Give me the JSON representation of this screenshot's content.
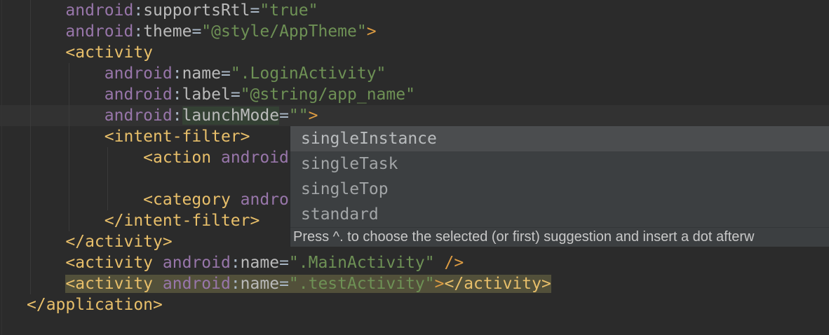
{
  "editor": {
    "background": "#2b2b2b",
    "caret_line_background": "#323232",
    "indent_guide_color": "#3a3a3a",
    "edge_line_color": "#343434",
    "colors": {
      "plain": "#a9b7c6",
      "tag": "#e8bf6a",
      "bracket": "#dd9c42",
      "ns": "#9876aa",
      "attr": "#bababa",
      "punct": "#a9b7c6",
      "str": "#6e9155"
    },
    "highlights": {
      "identifier": "#344134",
      "weak_warning": "#52503a"
    },
    "lines": [
      {
        "tokens": [
          {
            "t": "    "
          },
          {
            "t": "android",
            "c": "ns"
          },
          {
            "t": ":",
            "c": "punct"
          },
          {
            "t": "supportsRtl",
            "c": "attr"
          },
          {
            "t": "=",
            "c": "punct"
          },
          {
            "t": "\"true\"",
            "c": "str"
          }
        ]
      },
      {
        "tokens": [
          {
            "t": "    "
          },
          {
            "t": "android",
            "c": "ns"
          },
          {
            "t": ":",
            "c": "punct"
          },
          {
            "t": "theme",
            "c": "attr"
          },
          {
            "t": "=",
            "c": "punct"
          },
          {
            "t": "\"@style/AppTheme\"",
            "c": "str"
          },
          {
            "t": ">",
            "c": "bracket"
          }
        ]
      },
      {
        "tokens": [
          {
            "t": "    "
          },
          {
            "t": "<activity",
            "c": "tag"
          }
        ]
      },
      {
        "tokens": [
          {
            "t": "        "
          },
          {
            "t": "android",
            "c": "ns"
          },
          {
            "t": ":",
            "c": "punct"
          },
          {
            "t": "name",
            "c": "attr"
          },
          {
            "t": "=",
            "c": "punct"
          },
          {
            "t": "\".LoginActivity\"",
            "c": "str"
          }
        ]
      },
      {
        "tokens": [
          {
            "t": "        "
          },
          {
            "t": "android",
            "c": "ns"
          },
          {
            "t": ":",
            "c": "punct"
          },
          {
            "t": "label",
            "c": "attr"
          },
          {
            "t": "=",
            "c": "punct"
          },
          {
            "t": "\"@string/app_name\"",
            "c": "str"
          }
        ]
      },
      {
        "tokens": [
          {
            "t": "        "
          },
          {
            "t": "android",
            "c": "ns"
          },
          {
            "t": ":",
            "c": "punct"
          },
          {
            "t": "launchMode",
            "c": "attr",
            "bg": "identifier"
          },
          {
            "t": "=",
            "c": "punct"
          },
          {
            "t": "\"\"",
            "c": "str"
          },
          {
            "t": ">",
            "c": "bracket"
          }
        ]
      },
      {
        "tokens": [
          {
            "t": "        "
          },
          {
            "t": "<intent-filter>",
            "c": "tag"
          }
        ]
      },
      {
        "tokens": [
          {
            "t": "            "
          },
          {
            "t": "<action",
            "c": "tag"
          },
          {
            "t": " "
          },
          {
            "t": "android",
            "c": "ns"
          }
        ]
      },
      {
        "tokens": []
      },
      {
        "tokens": [
          {
            "t": "            "
          },
          {
            "t": "<category",
            "c": "tag"
          },
          {
            "t": " "
          },
          {
            "t": "andro",
            "c": "ns"
          }
        ]
      },
      {
        "tokens": [
          {
            "t": "        "
          },
          {
            "t": "</intent-filter>",
            "c": "tag"
          }
        ]
      },
      {
        "tokens": [
          {
            "t": "    "
          },
          {
            "t": "</activity>",
            "c": "tag"
          }
        ]
      },
      {
        "tokens": [
          {
            "t": "    "
          },
          {
            "t": "<activity",
            "c": "tag"
          },
          {
            "t": " "
          },
          {
            "t": "android",
            "c": "ns"
          },
          {
            "t": ":",
            "c": "punct"
          },
          {
            "t": "name",
            "c": "attr"
          },
          {
            "t": "=",
            "c": "punct"
          },
          {
            "t": "\".MainActivity\"",
            "c": "str"
          },
          {
            "t": " "
          },
          {
            "t": "/>",
            "c": "bracket"
          }
        ]
      },
      {
        "tokens": [
          {
            "t": "    "
          },
          {
            "t": "<activity",
            "c": "tag",
            "bg": "weak_warning"
          },
          {
            "t": " ",
            "bg": "weak_warning"
          },
          {
            "t": "android",
            "c": "ns",
            "bg": "weak_warning"
          },
          {
            "t": ":",
            "c": "punct",
            "bg": "weak_warning"
          },
          {
            "t": "name",
            "c": "attr",
            "bg": "weak_warning"
          },
          {
            "t": "=",
            "c": "punct",
            "bg": "weak_warning"
          },
          {
            "t": "\".testActivity\"",
            "c": "str",
            "bg": "weak_warning"
          },
          {
            "t": ">",
            "c": "bracket",
            "bg": "weak_warning"
          },
          {
            "t": "</activity>",
            "c": "tag",
            "bg": "weak_warning"
          }
        ]
      },
      {
        "tokens": [
          {
            "t": "</application>",
            "c": "tag"
          }
        ]
      }
    ]
  },
  "popup": {
    "background": "#3c3f41",
    "selected_background": "#4b4d4f",
    "item_color": "#a2a5a7",
    "selected_item_color": "#b9bcbe",
    "hint_color": "#c8c8c8",
    "selected_index": 0,
    "items": [
      {
        "label": "singleInstance"
      },
      {
        "label": "singleTask"
      },
      {
        "label": "singleTop"
      },
      {
        "label": "standard"
      }
    ],
    "hint": "Press ^. to choose the selected (or first) suggestion and insert a dot afterw"
  }
}
